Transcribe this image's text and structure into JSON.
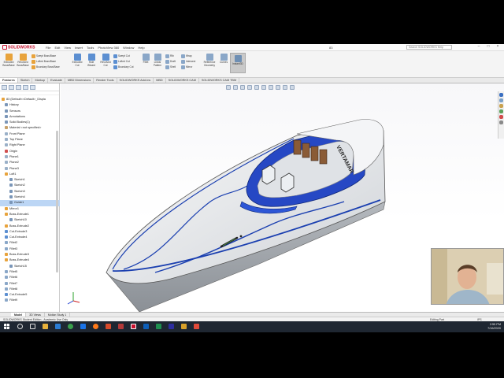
{
  "app": {
    "logo_text": "SOLIDWORKS",
    "menus": [
      "File",
      "Edit",
      "View",
      "Insert",
      "Tools",
      "PhotoView 360",
      "Window",
      "Help"
    ],
    "window_title": "83",
    "search_placeholder": "Search SOLIDWORKS Help"
  },
  "ribbon": {
    "big_buttons": [
      {
        "label": "Extruded Boss/Base",
        "color": "#e8a33c"
      },
      {
        "label": "Revolved Boss/Base",
        "color": "#e8a33c"
      },
      {
        "label": "Extruded Cut",
        "color": "#5c8fd1"
      },
      {
        "label": "Hole Wizard",
        "color": "#5c8fd1"
      },
      {
        "label": "Revolved Cut",
        "color": "#5c8fd1"
      },
      {
        "label": "Fillet",
        "color": "#8aa7c8"
      },
      {
        "label": "Linear Pattern",
        "color": "#8aa7c8"
      },
      {
        "label": "Reference Geometry",
        "color": "#8aa7c8"
      },
      {
        "label": "Curves",
        "color": "#8aa7c8"
      },
      {
        "label": "Instant3D",
        "color": "#6e8fb4"
      }
    ],
    "small_buttons": [
      {
        "label": "Swept Boss/Base",
        "color": "#e8a33c"
      },
      {
        "label": "Lofted Boss/Base",
        "color": "#e8a33c"
      },
      {
        "label": "Boundary Boss/Base",
        "color": "#e8a33c"
      },
      {
        "label": "Swept Cut",
        "color": "#5c8fd1"
      },
      {
        "label": "Lofted Cut",
        "color": "#5c8fd1"
      },
      {
        "label": "Boundary Cut",
        "color": "#5c8fd1"
      },
      {
        "label": "Rib",
        "color": "#8aa7c8"
      },
      {
        "label": "Draft",
        "color": "#8aa7c8"
      },
      {
        "label": "Shell",
        "color": "#8aa7c8"
      },
      {
        "label": "Wrap",
        "color": "#8aa7c8"
      },
      {
        "label": "Intersect",
        "color": "#8aa7c8"
      },
      {
        "label": "Mirror",
        "color": "#8aa7c8"
      }
    ]
  },
  "tabs": [
    "Features",
    "Sketch",
    "Markup",
    "Evaluate",
    "MBD Dimensions",
    "Render Tools",
    "SOLIDWORKS Add-Ins",
    "MBD",
    "SOLIDWORKS CAM",
    "SOLIDWORKS CAM TBM"
  ],
  "tree": [
    {
      "label": "83 (Default<<Default>_Displa",
      "color": "#e8a33c"
    },
    {
      "label": "History",
      "color": "#7a96b8"
    },
    {
      "label": "Sensors",
      "color": "#7a96b8"
    },
    {
      "label": "Annotations",
      "color": "#7a96b8"
    },
    {
      "label": "Solid Bodies(1)",
      "color": "#7a96b8"
    },
    {
      "label": "Material <not specified>",
      "color": "#c7a16b"
    },
    {
      "label": "Front Plane",
      "color": "#9ab0c8"
    },
    {
      "label": "Top Plane",
      "color": "#9ab0c8"
    },
    {
      "label": "Right Plane",
      "color": "#9ab0c8"
    },
    {
      "label": "Origin",
      "color": "#d15050"
    },
    {
      "label": "Plane1",
      "color": "#9ab0c8"
    },
    {
      "label": "Plane2",
      "color": "#9ab0c8"
    },
    {
      "label": "Plane3",
      "color": "#9ab0c8"
    },
    {
      "label": "Loft1",
      "color": "#e8a33c"
    },
    {
      "label": "Sketch1",
      "color": "#7a96b8"
    },
    {
      "label": "Sketch2",
      "color": "#7a96b8"
    },
    {
      "label": "Sketch3",
      "color": "#7a96b8"
    },
    {
      "label": "Sketch4",
      "color": "#7a96b8"
    },
    {
      "label": "Guide1",
      "color": "#7a96b8"
    },
    {
      "label": "Mirror1",
      "color": "#e8a33c"
    },
    {
      "label": "Boss-Extrude1",
      "color": "#e8a33c"
    },
    {
      "label": "Sketch10",
      "color": "#7a96b8"
    },
    {
      "label": "Boss-Extrude2",
      "color": "#e8a33c"
    },
    {
      "label": "Cut-Extrude3",
      "color": "#5c8fd1"
    },
    {
      "label": "Cut-Extrude4",
      "color": "#5c8fd1"
    },
    {
      "label": "Fillet2",
      "color": "#8aa7c8"
    },
    {
      "label": "Fillet3",
      "color": "#8aa7c8"
    },
    {
      "label": "Boss-Extrude3",
      "color": "#e8a33c"
    },
    {
      "label": "Boss-Extrude4",
      "color": "#e8a33c"
    },
    {
      "label": "Sketch15",
      "color": "#7a96b8"
    },
    {
      "label": "Fillet5",
      "color": "#8aa7c8"
    },
    {
      "label": "Fillet6",
      "color": "#8aa7c8"
    },
    {
      "label": "Fillet7",
      "color": "#8aa7c8"
    },
    {
      "label": "Fillet8",
      "color": "#8aa7c8"
    },
    {
      "label": "Cut-Extrude5",
      "color": "#5c8fd1"
    },
    {
      "label": "Fillet9",
      "color": "#8aa7c8"
    }
  ],
  "model": {
    "hull_text": "VERTAMAR"
  },
  "bottom_tabs": [
    "Model",
    "3D Views",
    "Motion Study 1"
  ],
  "status": {
    "left": "SOLIDWORKS Student Edition - Academic Use Only",
    "mode": "Editing Part",
    "units": "IPS"
  },
  "taskbar": {
    "time": "2:55 PM",
    "date": "7/16/2020"
  }
}
